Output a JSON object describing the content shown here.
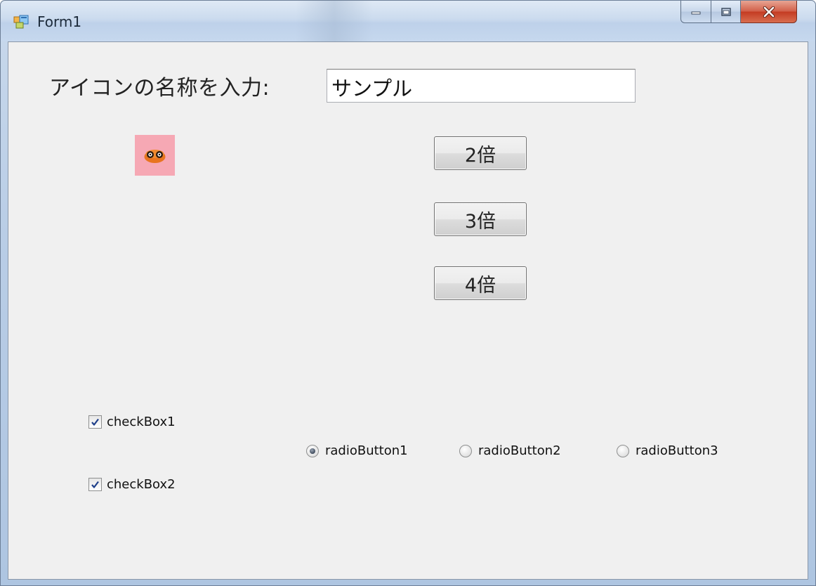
{
  "window": {
    "title": "Form1",
    "controls": [
      "minimize-icon",
      "maximize-icon",
      "close-icon"
    ]
  },
  "form": {
    "name_label": "アイコンの名称を入力:",
    "name_input_value": "サンプル",
    "picture_icon": "owl-eyes-icon",
    "scale_buttons": [
      "2倍",
      "3倍",
      "4倍"
    ],
    "checkboxes": [
      {
        "label": "checkBox1",
        "checked": true
      },
      {
        "label": "checkBox2",
        "checked": true
      }
    ],
    "radios": [
      {
        "label": "radioButton1",
        "selected": true
      },
      {
        "label": "radioButton2",
        "selected": false
      },
      {
        "label": "radioButton3",
        "selected": false
      }
    ]
  },
  "colors": {
    "client_bg": "#f0f0f0",
    "picture_bg": "#f6a8b4",
    "close_button": "#c43c23"
  }
}
